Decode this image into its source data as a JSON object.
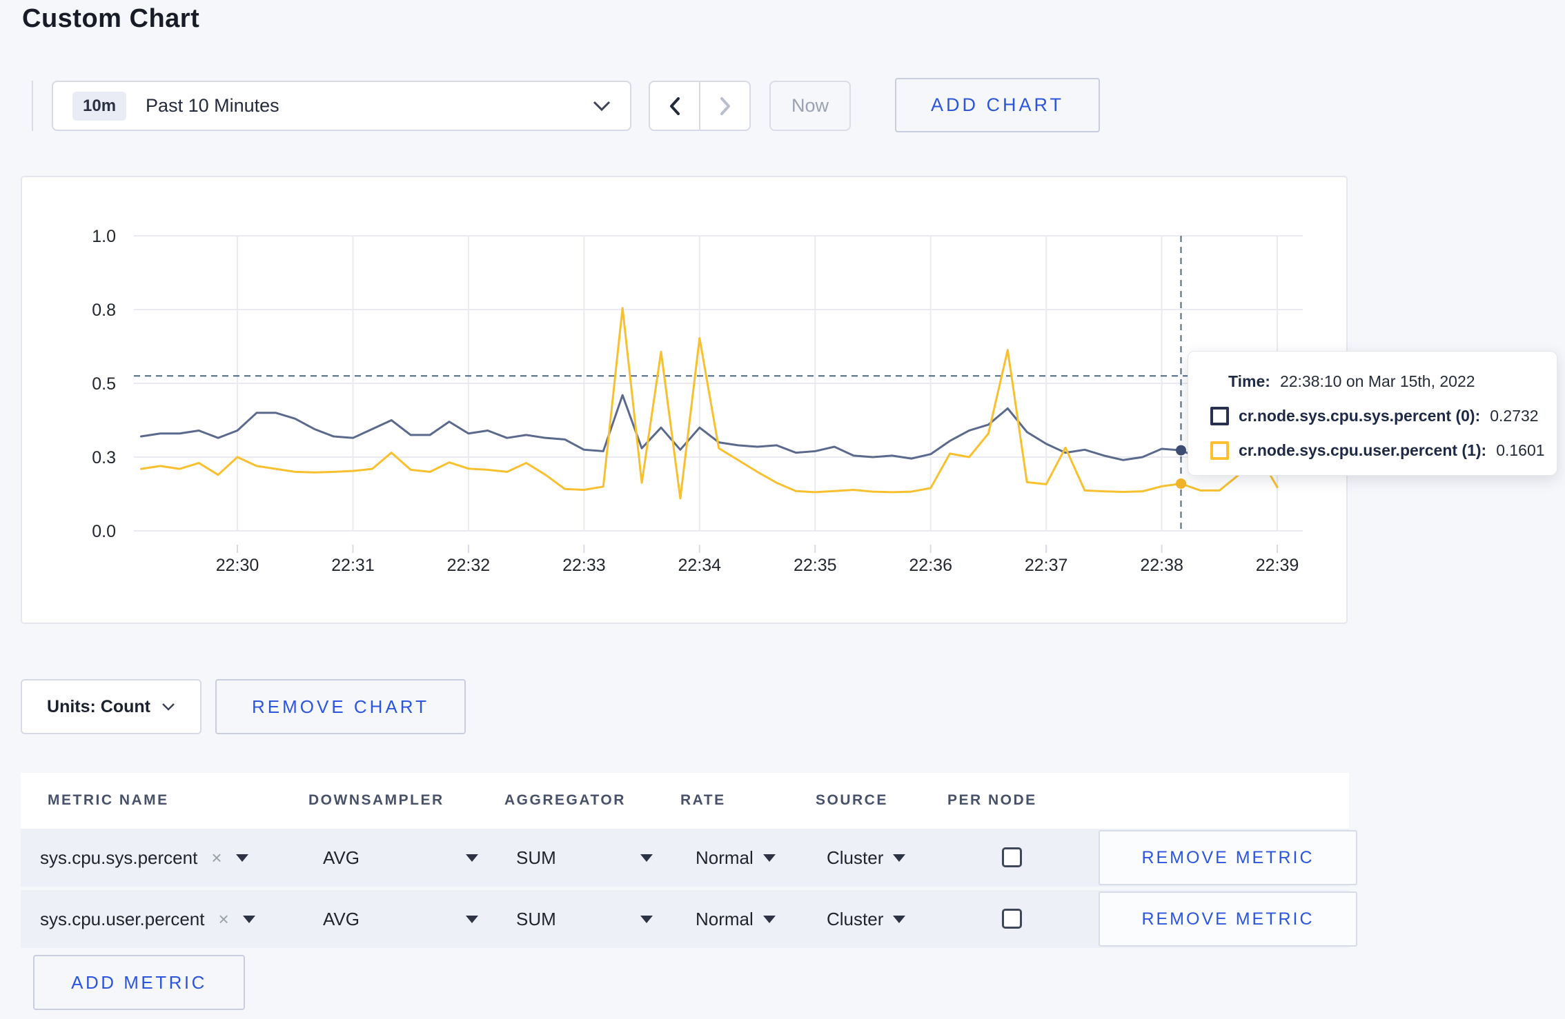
{
  "page": {
    "title": "Custom Chart"
  },
  "toolbar": {
    "time_badge": "10m",
    "time_range_label": "Past 10 Minutes",
    "now_label": "Now",
    "add_chart_label": "ADD CHART"
  },
  "chart_data": {
    "type": "line",
    "title": "",
    "xlabel": "",
    "ylabel": "",
    "ylim": [
      0,
      1
    ],
    "grid": true,
    "legend_position": "tooltip",
    "x_start_time": "22:29:10",
    "x_step_seconds": 10,
    "x_tick_labels": [
      "22:30",
      "22:31",
      "22:32",
      "22:33",
      "22:34",
      "22:35",
      "22:36",
      "22:37",
      "22:38",
      "22:39"
    ],
    "x_first_tick_index": 5,
    "x_tick_every": 6,
    "y_ticks": {
      "values": [
        1,
        0.75,
        0.5,
        0.25,
        0
      ],
      "labels": [
        "1.0",
        "0.8",
        "0.5",
        "0.3",
        "0.0"
      ]
    },
    "series": [
      {
        "name": "cr.node.sys.cpu.sys.percent (0)",
        "color": "#5a698c",
        "dot_color": "#3f4e74",
        "values": [
          0.32,
          0.33,
          0.33,
          0.34,
          0.315,
          0.34,
          0.4,
          0.4,
          0.38,
          0.345,
          0.32,
          0.315,
          0.345,
          0.375,
          0.325,
          0.325,
          0.37,
          0.33,
          0.34,
          0.315,
          0.325,
          0.315,
          0.31,
          0.275,
          0.27,
          0.46,
          0.28,
          0.35,
          0.275,
          0.35,
          0.3,
          0.29,
          0.285,
          0.29,
          0.265,
          0.27,
          0.285,
          0.255,
          0.25,
          0.255,
          0.245,
          0.26,
          0.305,
          0.34,
          0.36,
          0.415,
          0.335,
          0.295,
          0.265,
          0.275,
          0.255,
          0.24,
          0.25,
          0.278,
          0.2732,
          0.245,
          0.26,
          0.3,
          0.295,
          0.3
        ]
      },
      {
        "name": "cr.node.sys.cpu.user.percent (1)",
        "color": "#f8c02e",
        "dot_color": "#f2b32b",
        "values": [
          0.21,
          0.22,
          0.21,
          0.23,
          0.19,
          0.25,
          0.22,
          0.21,
          0.2,
          0.198,
          0.2,
          0.203,
          0.21,
          0.265,
          0.207,
          0.2,
          0.232,
          0.211,
          0.207,
          0.2,
          0.23,
          0.19,
          0.142,
          0.139,
          0.15,
          0.755,
          0.163,
          0.607,
          0.11,
          0.653,
          0.28,
          0.24,
          0.2,
          0.163,
          0.135,
          0.131,
          0.135,
          0.139,
          0.133,
          0.131,
          0.133,
          0.145,
          0.262,
          0.25,
          0.33,
          0.613,
          0.165,
          0.158,
          0.282,
          0.137,
          0.134,
          0.132,
          0.134,
          0.151,
          0.1601,
          0.137,
          0.137,
          0.19,
          0.26,
          0.148
        ]
      }
    ],
    "crosshair": {
      "index": 54,
      "time": "22:38:10",
      "y_value": 0.525
    },
    "colors": {
      "grid": "#e9ebf0",
      "axis_text": "#22272f",
      "dashed": "#4e6781",
      "tick": "#d8dbe3"
    }
  },
  "tooltip": {
    "time_label": "Time:",
    "time_value": "22:38:10 on Mar 15th, 2022",
    "rows": [
      {
        "label": "cr.node.sys.cpu.sys.percent (0):",
        "value": "0.2732",
        "color": "#26324e"
      },
      {
        "label": "cr.node.sys.cpu.user.percent (1):",
        "value": "0.1601",
        "color": "#fdc032"
      }
    ]
  },
  "chart_footer": {
    "units_label": "Units: Count",
    "remove_chart_label": "REMOVE CHART"
  },
  "metrics_table": {
    "headers": [
      "METRIC NAME",
      "DOWNSAMPLER",
      "AGGREGATOR",
      "RATE",
      "SOURCE",
      "PER NODE"
    ],
    "rows": [
      {
        "metric": "sys.cpu.sys.percent",
        "downsampler": "AVG",
        "aggregator": "SUM",
        "rate": "Normal",
        "source": "Cluster",
        "per_node_checked": false,
        "remove_label": "REMOVE METRIC"
      },
      {
        "metric": "sys.cpu.user.percent",
        "downsampler": "AVG",
        "aggregator": "SUM",
        "rate": "Normal",
        "source": "Cluster",
        "per_node_checked": false,
        "remove_label": "REMOVE METRIC"
      }
    ],
    "add_metric_label": "ADD METRIC"
  },
  "icons": {
    "close": "×"
  }
}
